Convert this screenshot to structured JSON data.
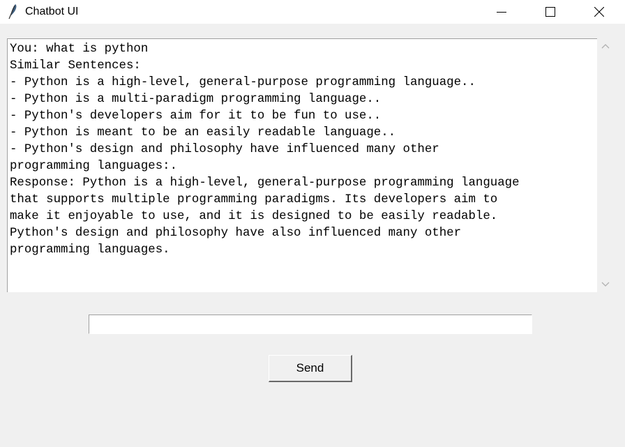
{
  "window": {
    "title": "Chatbot UI",
    "app_icon": "feather-icon",
    "controls": [
      "minimize-icon",
      "maximize-icon",
      "close-icon"
    ]
  },
  "chat_log": {
    "lines": [
      "You: what is python",
      "Similar Sentences:",
      "- Python is a high-level, general-purpose programming language..",
      "- Python is a multi-paradigm programming language..",
      "- Python's developers aim for it to be fun to use..",
      "- Python is meant to be an easily readable language..",
      "- Python's design and philosophy have influenced many other",
      "programming languages:.",
      "Response: Python is a high-level, general-purpose programming language",
      "that supports multiple programming paradigms. Its developers aim to",
      "make it enjoyable to use, and it is designed to be easily readable.",
      "Python's design and philosophy have also influenced many other",
      "programming languages."
    ]
  },
  "input": {
    "value": ""
  },
  "send_button": {
    "label": "Send"
  },
  "colors": {
    "window_bg": "#f0f0f0",
    "titlebar_bg": "#ffffff",
    "text": "#000000"
  }
}
